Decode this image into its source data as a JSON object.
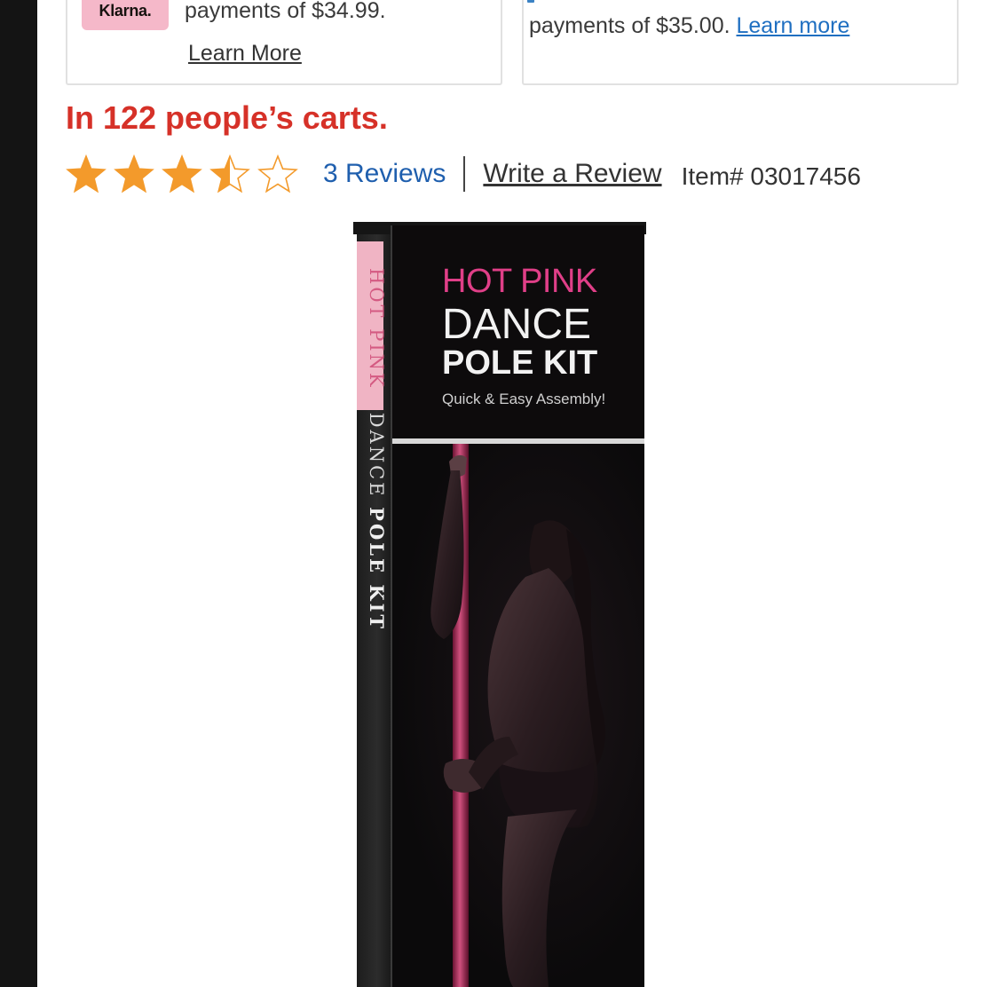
{
  "payments": {
    "klarna": {
      "badge": "Klarna.",
      "text": "payments of $34.99.",
      "learn_more": "Learn More"
    },
    "other": {
      "text": "payments of $35.00.",
      "learn_more": "Learn more"
    }
  },
  "carts": "In 122 people’s carts.",
  "rating": {
    "value": 3.5,
    "max": 5,
    "reviews": "3 Reviews",
    "write_review": "Write a Review",
    "item_number": "Item# 03017456",
    "star_color": "#f39a2b"
  },
  "product_box": {
    "title_line1": "HOT PINK",
    "title_line2": "DANCE",
    "title_line3": "POLE KIT",
    "tagline": "Quick & Easy Assembly!",
    "spine_hot_pink": "HOT PINK",
    "spine_dance": "DANCE",
    "spine_pole_kit": "POLE KIT"
  },
  "colors": {
    "alert_red": "#d63128",
    "link_blue": "#1f5fae",
    "klarna_pink": "#f5b8c9",
    "brand_pink": "#e03f88"
  }
}
